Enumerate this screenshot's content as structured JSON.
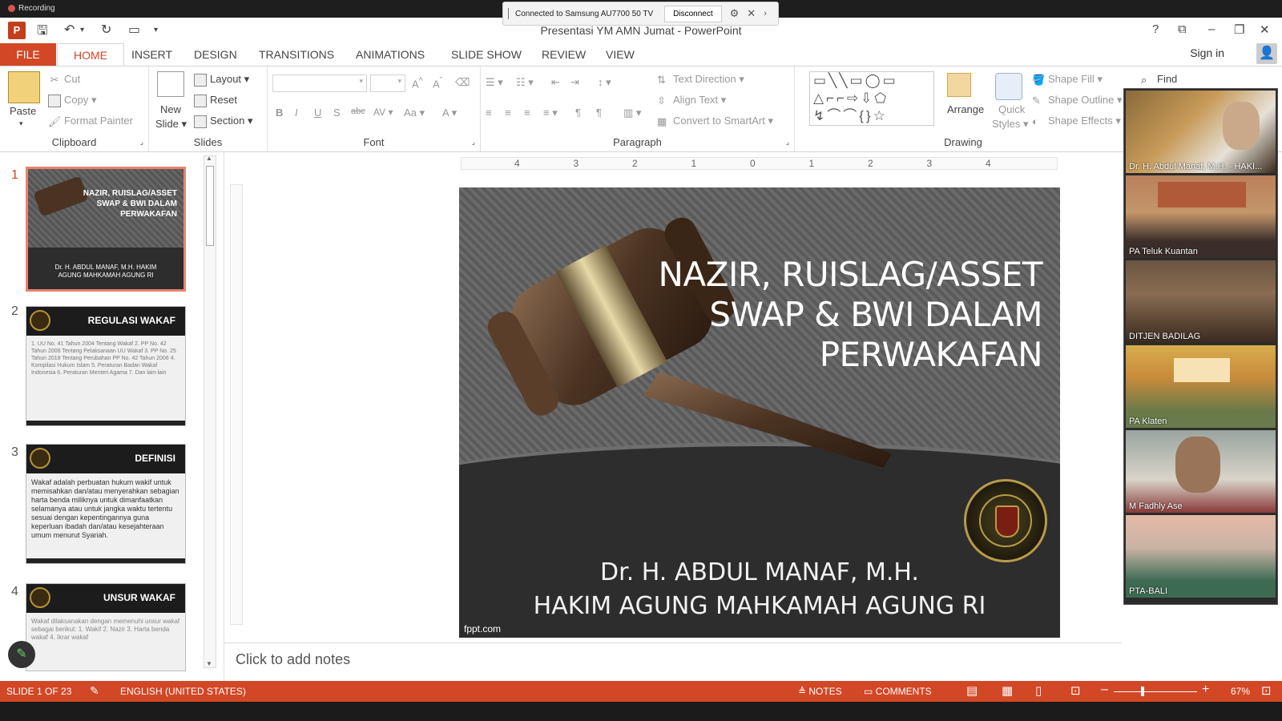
{
  "recording": {
    "label": "Recording"
  },
  "cast": {
    "status": "Connected to Samsung AU7700 50 TV",
    "disconnect": "Disconnect"
  },
  "window": {
    "title": "Presentasi YM AMN Jumat - PowerPoint"
  },
  "tabs": [
    "FILE",
    "HOME",
    "INSERT",
    "DESIGN",
    "TRANSITIONS",
    "ANIMATIONS",
    "SLIDE SHOW",
    "REVIEW",
    "VIEW"
  ],
  "account": {
    "signin": "Sign in"
  },
  "ribbon": {
    "clipboard": {
      "paste": "Paste",
      "cut": "Cut",
      "copy": "Copy",
      "format_painter": "Format Painter",
      "label": "Clipboard"
    },
    "slides": {
      "new_slide": "New",
      "new_slide2": "Slide",
      "layout": "Layout",
      "reset": "Reset",
      "section": "Section",
      "label": "Slides"
    },
    "font": {
      "label": "Font"
    },
    "paragraph": {
      "text_direction": "Text Direction",
      "align_text": "Align Text",
      "convert_smartart": "Convert to SmartArt",
      "label": "Paragraph"
    },
    "drawing": {
      "arrange": "Arrange",
      "quick": "Quick",
      "styles": "Styles",
      "shape_fill": "Shape Fill",
      "shape_outline": "Shape Outline",
      "shape_effects": "Shape Effects",
      "label": "Drawing"
    },
    "editing": {
      "find": "Find"
    }
  },
  "thumbnails": [
    {
      "num": "1",
      "title": "NAZIR, RUISLAG/ASSET SWAP & BWI DALAM PERWAKAFAN",
      "sub": "Dr. H. ABDUL MANAF, M.H. HAKIM AGUNG MAHKAMAH AGUNG RI"
    },
    {
      "num": "2",
      "title": "REGULASI WAKAF",
      "body": "1. UU No. 41 Tahun 2004 Tentang Wakaf 2. PP No. 42 Tahun 2006 Tentang Pelaksanaan UU Wakaf 3. PP No. 25 Tahun 2018 Tentang Perubahan PP No. 42 Tahun 2006 4. Kompilasi Hukum Islam 5. Peraturan Badan Wakaf Indonesia 6. Peraturan Menteri Agama 7. Dan lain-lain"
    },
    {
      "num": "3",
      "title": "DEFINISI",
      "body": "Wakaf adalah perbuatan hukum wakif untuk memisahkan dan/atau menyerahkan sebagian harta benda miliknya untuk dimanfaatkan selamanya atau untuk jangka waktu tertentu sesuai dengan kepentingannya guna keperluan ibadah dan/atau kesejahteraan umum menurut Syariah."
    },
    {
      "num": "4",
      "title": "UNSUR WAKAF",
      "body": "Wakaf dilaksanakan dengan memenuhi unsur wakaf sebagai berikut: 1. Wakif 2. Nazir 3. Harta benda wakaf 4. Ikrar wakaf"
    }
  ],
  "slide": {
    "title_l1": "NAZIR, RUISLAG/ASSET",
    "title_l2": "SWAP & BWI DALAM",
    "title_l3": "PERWAKAFAN",
    "author_l1": "Dr. H. ABDUL MANAF, M.H.",
    "author_l2": "HAKIM AGUNG MAHKAMAH AGUNG RI",
    "source": "fppt.com"
  },
  "ruler": {
    "ticks": [
      "4",
      "3",
      "2",
      "1",
      "0",
      "1",
      "2",
      "3",
      "4"
    ]
  },
  "notes": {
    "placeholder": "Click to add notes"
  },
  "participants": [
    {
      "name": "Dr. H. Abdul Manaf, M.H. - HAKI..."
    },
    {
      "name": "PA Teluk Kuantan"
    },
    {
      "name": "DITJEN BADILAG"
    },
    {
      "name": "PA Klaten"
    },
    {
      "name": "M Fadhly Ase"
    },
    {
      "name": "PTA-BALI"
    }
  ],
  "status": {
    "slide": "SLIDE 1 OF 23",
    "language": "ENGLISH (UNITED STATES)",
    "notes": "NOTES",
    "comments": "COMMENTS",
    "zoom": "67%"
  },
  "colors": {
    "accent": "#d24726",
    "selected_thumb_border": "#e8836c"
  }
}
